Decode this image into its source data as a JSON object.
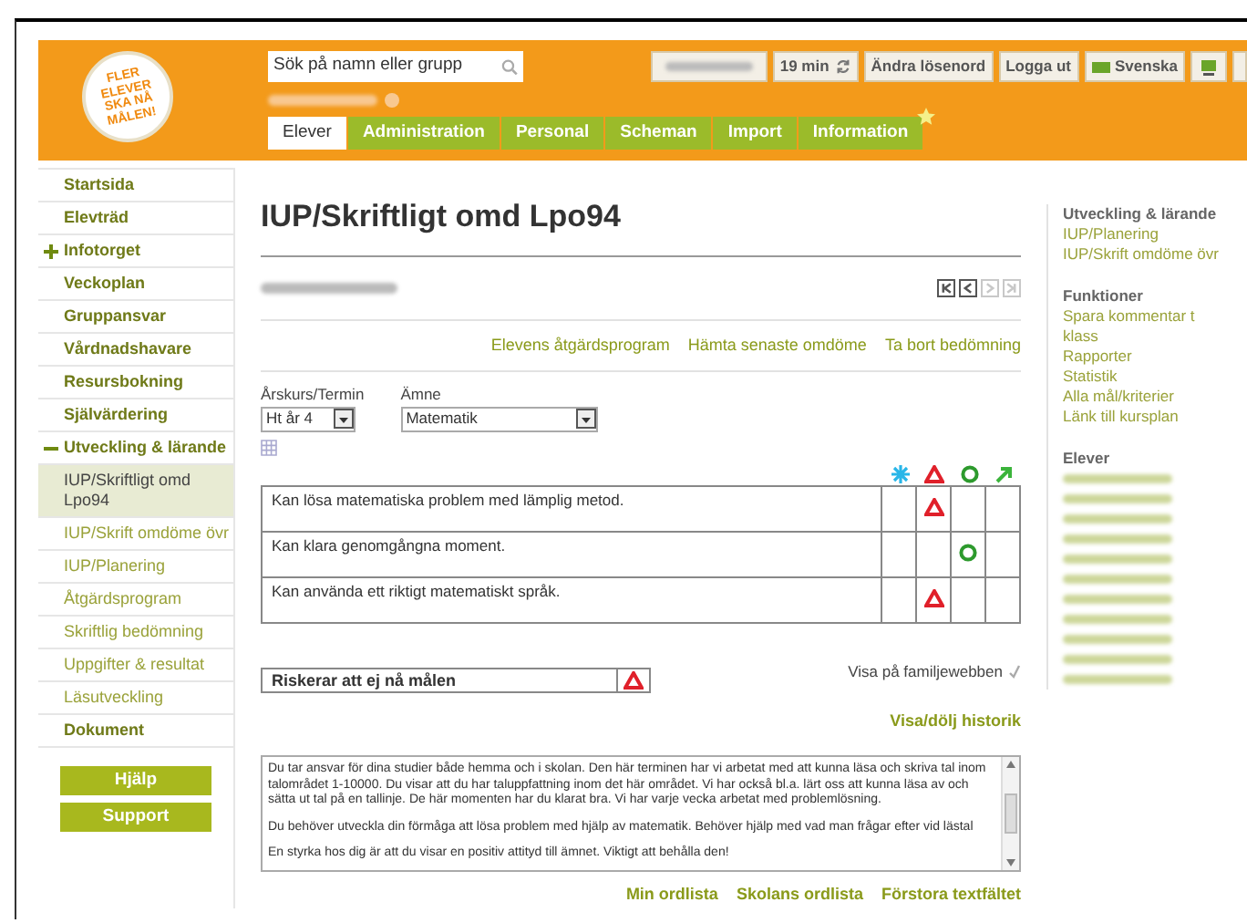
{
  "header": {
    "logo_text": "FLER ELEVER SKA NÅ MÅLEN!",
    "search": {
      "placeholder": "Sök på namn eller grupp"
    },
    "top_buttons": [
      {
        "kind": "blurred"
      },
      {
        "kind": "timer",
        "label": "19 min"
      },
      {
        "kind": "text",
        "label": "Ändra lösenord"
      },
      {
        "kind": "text",
        "label": "Logga ut"
      },
      {
        "kind": "flag",
        "label": "Svenska"
      },
      {
        "kind": "computer"
      },
      {
        "kind": "cut"
      }
    ],
    "tabs": [
      {
        "label": "Elever",
        "selected": true
      },
      {
        "label": "Administration",
        "selected": false
      },
      {
        "label": "Personal",
        "selected": false
      },
      {
        "label": "Scheman",
        "selected": false
      },
      {
        "label": "Import",
        "selected": false
      },
      {
        "label": "Information",
        "selected": false
      }
    ]
  },
  "sidebar": {
    "items": [
      {
        "label": "Startsida",
        "selected": false
      },
      {
        "label": "Elevträd",
        "selected": false
      },
      {
        "label": "Infotorget",
        "selected": false,
        "expanded": false
      },
      {
        "label": "Veckoplan",
        "selected": false
      },
      {
        "label": "Gruppansvar",
        "selected": false
      },
      {
        "label": "Vårdnadshavare",
        "selected": false
      },
      {
        "label": "Resursbokning",
        "selected": false
      },
      {
        "label": "Självärdering",
        "selected": false
      },
      {
        "label": "Utveckling & lärande",
        "selected": false,
        "expanded": true,
        "children": [
          {
            "label": "IUP/Skriftligt omd Lpo94",
            "selected": true
          },
          {
            "label": "IUP/Skrift omdöme övr",
            "selected": false
          },
          {
            "label": "IUP/Planering",
            "selected": false
          },
          {
            "label": "Åtgärdsprogram",
            "selected": false
          },
          {
            "label": "Skriftlig bedömning",
            "selected": false
          },
          {
            "label": "Uppgifter & resultat",
            "selected": false
          },
          {
            "label": "Läsutveckling",
            "selected": false
          }
        ]
      },
      {
        "label": "Dokument",
        "selected": false
      }
    ],
    "buttons": [
      "Hjälp",
      "Support"
    ]
  },
  "main": {
    "title": "IUP/Skriftligt omd Lpo94",
    "pager": [
      {
        "kind": "first",
        "disabled": false
      },
      {
        "kind": "prev",
        "disabled": false
      },
      {
        "kind": "next",
        "disabled": true
      },
      {
        "kind": "last",
        "disabled": true
      }
    ],
    "links": [
      "Elevens åtgärdsprogram",
      "Hämta senaste omdöme",
      "Ta bort bedömning"
    ],
    "selects": [
      {
        "label": "Årskurs/Termin",
        "value": "Ht år 4"
      },
      {
        "label": "Ämne",
        "value": "Matematik"
      }
    ],
    "grid_columns": [
      {
        "kind": "star"
      },
      {
        "kind": "triangle"
      },
      {
        "kind": "circle"
      },
      {
        "kind": "arrow"
      }
    ],
    "rows": [
      {
        "text": "Kan lösa matematiska problem med lämplig metod.",
        "cells": [
          {
            "marked": false
          },
          {
            "marked": true
          },
          {
            "marked": false
          },
          {
            "marked": false
          }
        ]
      },
      {
        "text": "Kan klara genomgångna moment.",
        "cells": [
          {
            "marked": false
          },
          {
            "marked": false
          },
          {
            "marked": true
          },
          {
            "marked": false
          }
        ]
      },
      {
        "text": "Kan använda ett riktigt matematiskt språk.",
        "cells": [
          {
            "marked": false
          },
          {
            "marked": true
          },
          {
            "marked": false
          },
          {
            "marked": false
          }
        ]
      }
    ],
    "risk": {
      "text": "Riskerar att ej nå målen",
      "icon": {
        "kind": "triangle"
      }
    },
    "family_web": {
      "label": "Visa på familjewebben",
      "checked": true
    },
    "history_link": "Visa/dölj historik",
    "comment": [
      "Du tar ansvar för dina studier både hemma och i skolan. Den här terminen har vi arbetat med att kunna läsa och skriva tal inom talområdet 1-10000. Du visar att du har taluppfattning inom det här området. Vi har också bl.a. lärt oss att kunna läsa av och sätta ut tal på en tallinje. De här momenten har du klarat bra. Vi har varje vecka arbetat med problemlösning.",
      "Du behöver utveckla din förmåga att lösa problem med hjälp av matematik. Behöver hjälp med vad man frågar efter vid lästal",
      "En styrka hos dig är att du visar en positiv attityd till ämnet. Viktigt att behålla den!"
    ],
    "bottom_links": [
      "Min ordlista",
      "Skolans ordlista",
      "Förstora textfältet"
    ]
  },
  "right": {
    "sections": [
      {
        "heading": "Utveckling & lärande",
        "links": [
          "IUP/Planering",
          "IUP/Skrift omdöme övr"
        ]
      },
      {
        "heading": "Funktioner",
        "links": [
          "Spara kommentar t klass",
          "Rapporter",
          "Statistik",
          "Alla mål/kriterier",
          "Länk till kursplan"
        ]
      },
      {
        "heading": "Elever",
        "students": [
          {
            "kind": "blurred"
          },
          {
            "kind": "blurred"
          },
          {
            "kind": "blurred"
          },
          {
            "kind": "blurred"
          },
          {
            "kind": "blurred"
          },
          {
            "kind": "blurred"
          },
          {
            "kind": "blurred"
          },
          {
            "kind": "blurred"
          },
          {
            "kind": "blurred"
          },
          {
            "kind": "blurred"
          },
          {
            "kind": "blurred"
          }
        ]
      }
    ]
  }
}
